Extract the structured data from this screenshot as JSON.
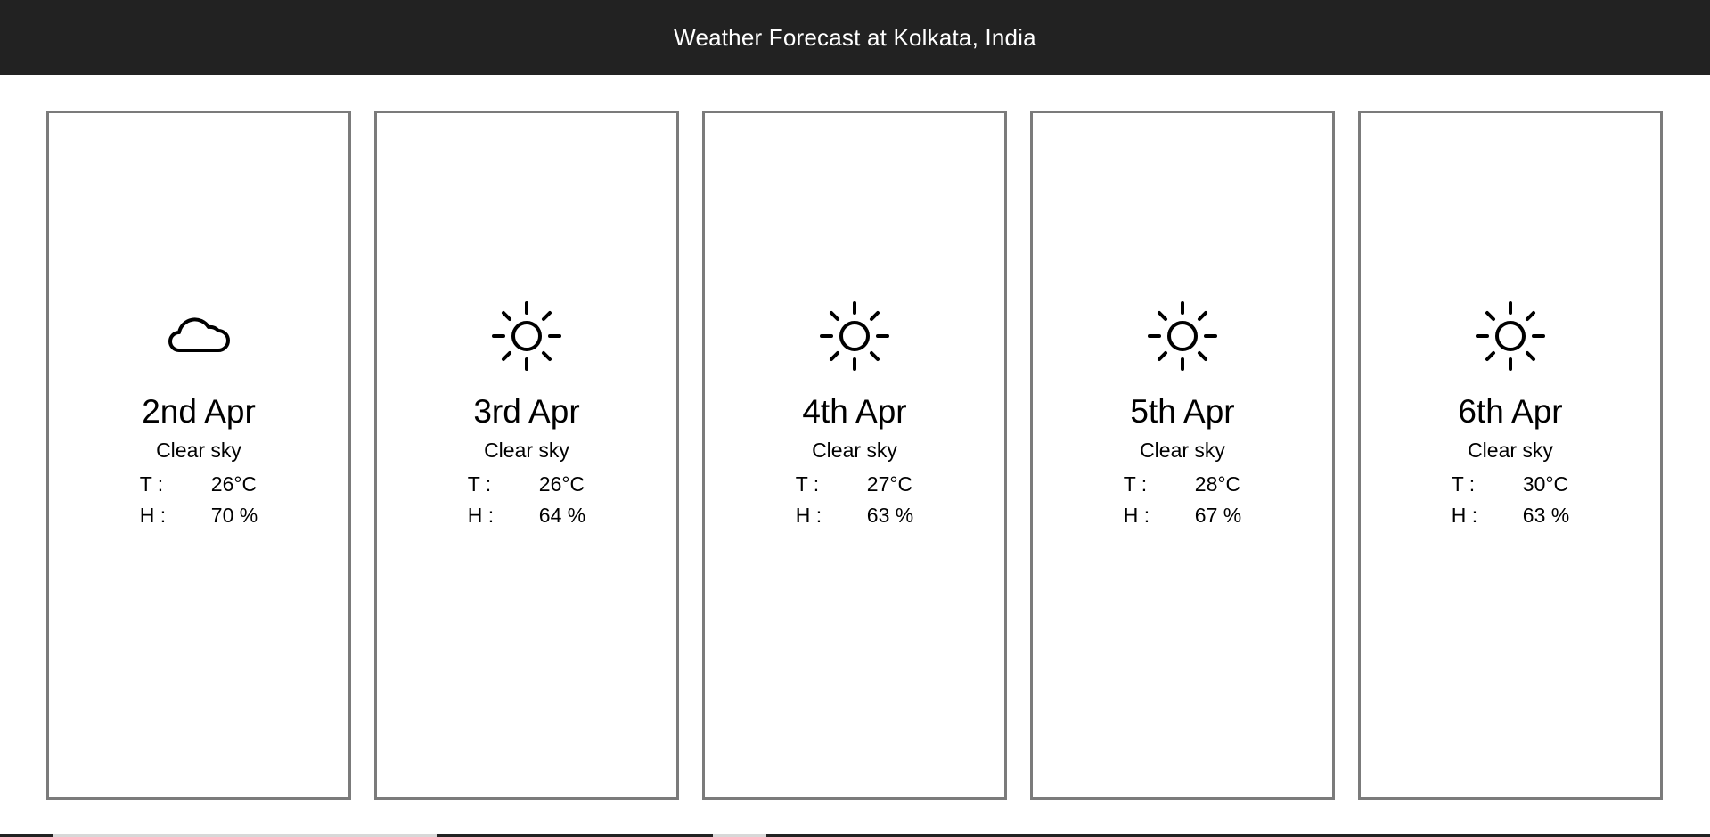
{
  "header": {
    "title": "Weather Forecast at Kolkata, India"
  },
  "labels": {
    "temperature": "T :",
    "humidity": "H :"
  },
  "days": [
    {
      "date": "2nd Apr",
      "condition": "Clear sky",
      "icon": "cloud-icon",
      "temp": "26°C",
      "humidity": "70 %"
    },
    {
      "date": "3rd Apr",
      "condition": "Clear sky",
      "icon": "sun-icon",
      "temp": "26°C",
      "humidity": "64 %"
    },
    {
      "date": "4th Apr",
      "condition": "Clear sky",
      "icon": "sun-icon",
      "temp": "27°C",
      "humidity": "63 %"
    },
    {
      "date": "5th Apr",
      "condition": "Clear sky",
      "icon": "sun-icon",
      "temp": "28°C",
      "humidity": "67 %"
    },
    {
      "date": "6th Apr",
      "condition": "Clear sky",
      "icon": "sun-icon",
      "temp": "30°C",
      "humidity": "63 %"
    }
  ]
}
